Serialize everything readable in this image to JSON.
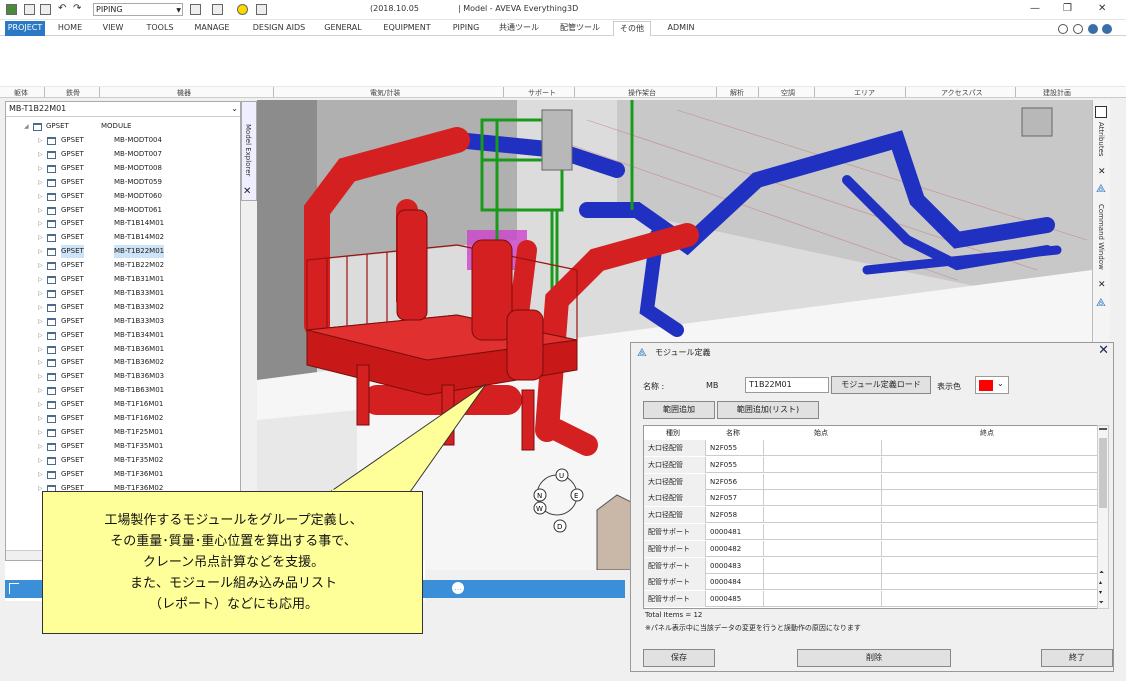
{
  "titlebar": {
    "combo_value": "PIPING",
    "date": "(2018.10.05",
    "title": "| Model - AVEVA Everything3D"
  },
  "tabs": [
    "PROJECT",
    "HOME",
    "VIEW",
    "TOOLS",
    "MANAGE",
    "DESIGN AIDS",
    "GENERAL",
    "EQUIPMENT",
    "PIPING",
    "共通ツール",
    "配管ツール",
    "その他",
    "ADMIN"
  ],
  "active_tab": "その他",
  "ribbon_groups": [
    "躯体",
    "鉄骨",
    "機器",
    "電気/計装",
    "サポート",
    "操作架台",
    "解析",
    "空調",
    "エリア",
    "アクセスパス",
    "建設計画"
  ],
  "explorer": {
    "title": "Model Explorer",
    "combo": "MB-T1B22M01",
    "root": {
      "gp": "GPSET",
      "md": "MODULE"
    },
    "rows": [
      {
        "gp": "GPSET",
        "md": "MB-MODT004"
      },
      {
        "gp": "GPSET",
        "md": "MB-MODT007"
      },
      {
        "gp": "GPSET",
        "md": "MB-MODT008"
      },
      {
        "gp": "GPSET",
        "md": "MB-MODT059"
      },
      {
        "gp": "GPSET",
        "md": "MB-MODT060"
      },
      {
        "gp": "GPSET",
        "md": "MB-MODT061"
      },
      {
        "gp": "GPSET",
        "md": "MB-T1B14M01"
      },
      {
        "gp": "GPSET",
        "md": "MB-T1B14M02"
      },
      {
        "gp": "GPSET",
        "md": "MB-T1B22M01"
      },
      {
        "gp": "GPSET",
        "md": "MB-T1B22M02"
      },
      {
        "gp": "GPSET",
        "md": "MB-T1B31M01"
      },
      {
        "gp": "GPSET",
        "md": "MB-T1B33M01"
      },
      {
        "gp": "GPSET",
        "md": "MB-T1B33M02"
      },
      {
        "gp": "GPSET",
        "md": "MB-T1B33M03"
      },
      {
        "gp": "GPSET",
        "md": "MB-T1B34M01"
      },
      {
        "gp": "GPSET",
        "md": "MB-T1B36M01"
      },
      {
        "gp": "GPSET",
        "md": "MB-T1B36M02"
      },
      {
        "gp": "GPSET",
        "md": "MB-T1B36M03"
      },
      {
        "gp": "GPSET",
        "md": "MB-T1B63M01"
      },
      {
        "gp": "GPSET",
        "md": "MB-T1F16M01"
      },
      {
        "gp": "GPSET",
        "md": "MB-T1F16M02"
      },
      {
        "gp": "GPSET",
        "md": "MB-T1F25M01"
      },
      {
        "gp": "GPSET",
        "md": "MB-T1F35M01"
      },
      {
        "gp": "GPSET",
        "md": "MB-T1F35M02"
      },
      {
        "gp": "GPSET",
        "md": "MB-T1F36M01"
      },
      {
        "gp": "GPSET",
        "md": "MB-T1F36M02"
      }
    ],
    "selected_index": 8
  },
  "right_panels": [
    "Attributes",
    "Command Window"
  ],
  "dialog": {
    "title": "モジュール定義",
    "name_label": "名称 :",
    "prefix": "MB",
    "name_value": "T1B22M01",
    "load_button": "モジュール定義ロード",
    "color_label": "表示色",
    "color": "#ff0000",
    "add_range": "範囲追加",
    "add_range_list": "範囲追加(リスト)",
    "columns": [
      "種別",
      "名称",
      "始点",
      "終点"
    ],
    "rows": [
      {
        "kind": "大口径配管",
        "name": "N2F055"
      },
      {
        "kind": "大口径配管",
        "name": "N2F055"
      },
      {
        "kind": "大口径配管",
        "name": "N2F056"
      },
      {
        "kind": "大口径配管",
        "name": "N2F057"
      },
      {
        "kind": "大口径配管",
        "name": "N2F058"
      },
      {
        "kind": "配管サポート",
        "name": "0000481"
      },
      {
        "kind": "配管サポート",
        "name": "0000482"
      },
      {
        "kind": "配管サポート",
        "name": "0000483"
      },
      {
        "kind": "配管サポート",
        "name": "0000484"
      },
      {
        "kind": "配管サポート",
        "name": "0000485"
      }
    ],
    "total": "Total Items = 12",
    "note": "※パネル表示中に当該データの変更を行うと誤動作の原因になります",
    "save": "保存",
    "delete": "削除",
    "close": "終了"
  },
  "callout": {
    "lines": [
      "工場製作するモジュールをグループ定義し、",
      "その重量･質量･重心位置を算出する事で、",
      "クレーン吊点計算などを支援。",
      "また、モジュール組み込み品リスト",
      "（レポート）などにも応用。"
    ]
  },
  "compass": {
    "u": "U",
    "n": "N",
    "e": "E",
    "w": "W",
    "s": "S",
    "d": "D"
  },
  "colors": {
    "pipe_red": "#d42020",
    "pipe_blue": "#2030c0",
    "structure_green": "#1a9a1a",
    "accent": "#2b78c5"
  }
}
